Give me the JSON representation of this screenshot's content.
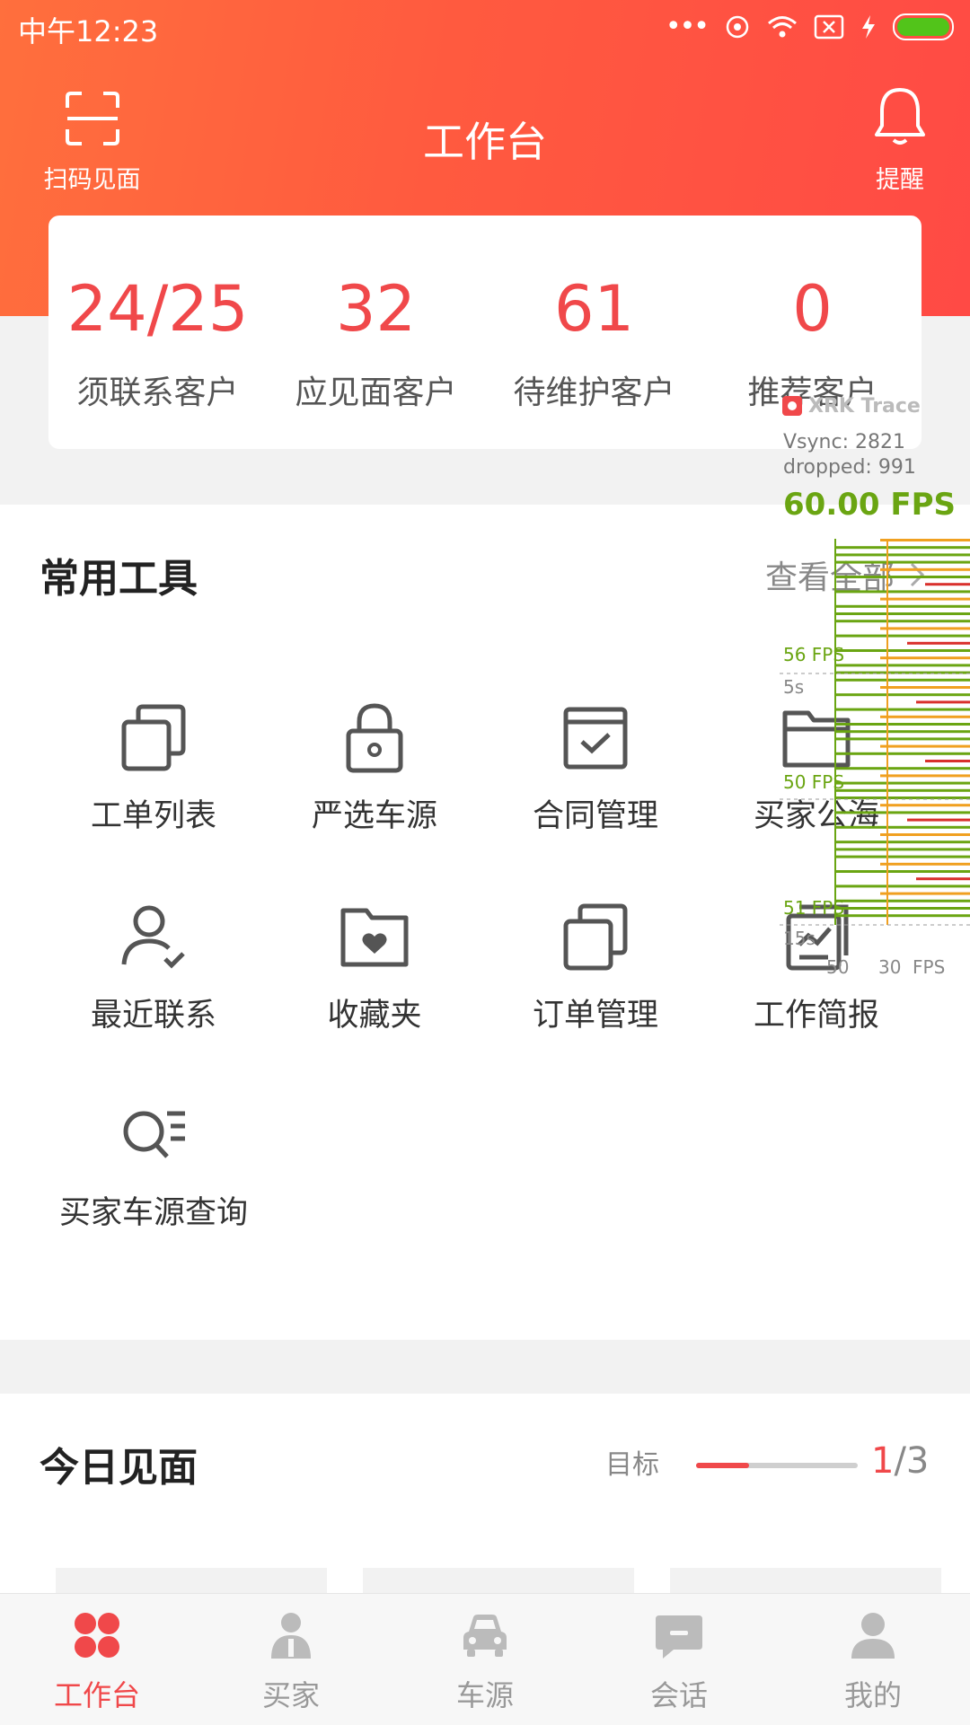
{
  "status_bar": {
    "time": "中午12:23",
    "battery_color": "#52c41a"
  },
  "header": {
    "title": "工作台",
    "scan_label": "扫码见面",
    "remind_label": "提醒"
  },
  "stats": [
    {
      "value": "24/25",
      "label": "须联系客户"
    },
    {
      "value": "32",
      "label": "应见面客户"
    },
    {
      "value": "61",
      "label": "待维护客户"
    },
    {
      "value": "0",
      "label": "推荐客户"
    }
  ],
  "tools": {
    "title": "常用工具",
    "view_all": "查看全部",
    "items": [
      {
        "label": "工单列表",
        "icon": "copy-icon"
      },
      {
        "label": "严选车源",
        "icon": "lock-icon"
      },
      {
        "label": "合同管理",
        "icon": "contract-check-icon"
      },
      {
        "label": "买家公海",
        "icon": "folder-icon"
      },
      {
        "label": "最近联系",
        "icon": "user-check-icon"
      },
      {
        "label": "收藏夹",
        "icon": "favorite-folder-icon"
      },
      {
        "label": "订单管理",
        "icon": "copy-icon"
      },
      {
        "label": "工作简报",
        "icon": "report-icon"
      },
      {
        "label": "买家车源查询",
        "icon": "search-list-icon"
      }
    ]
  },
  "today": {
    "title": "今日见面",
    "goal_label": "目标",
    "goal_current": "1",
    "goal_total": "/3",
    "progress_fraction": 0.33
  },
  "tabbar": {
    "items": [
      {
        "label": "工作台",
        "icon": "workbench-icon",
        "active": true
      },
      {
        "label": "买家",
        "icon": "buyer-icon",
        "active": false
      },
      {
        "label": "车源",
        "icon": "car-icon",
        "active": false
      },
      {
        "label": "会话",
        "icon": "chat-icon",
        "active": false
      },
      {
        "label": "我的",
        "icon": "profile-icon",
        "active": false
      }
    ]
  },
  "trace_overlay": {
    "title": "XRK Trace",
    "vsync": "Vsync: 2821",
    "dropped": "dropped: 991",
    "fps": "60.00 FPS",
    "markers": [
      "56 FPS",
      "5s",
      "50 FPS",
      "51 FPS",
      "15s"
    ],
    "axis": [
      "50",
      "30",
      "FPS"
    ]
  },
  "colors": {
    "accent": "#f0484a",
    "header_start": "#ff6f3d",
    "header_end": "#ff4a45"
  }
}
